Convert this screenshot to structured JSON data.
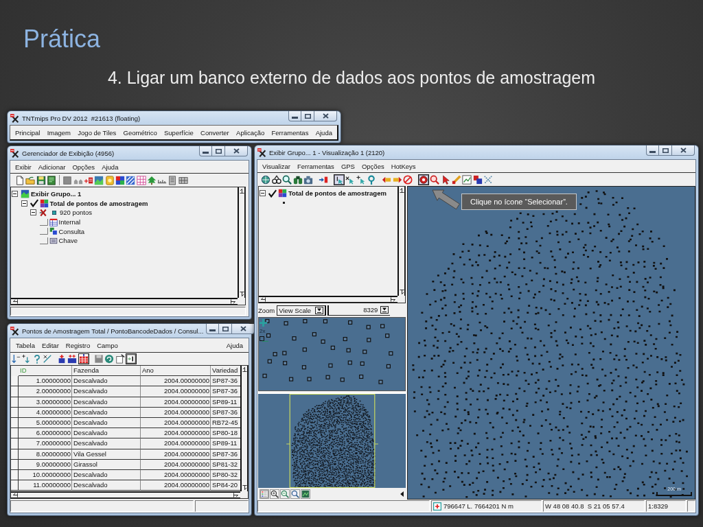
{
  "slide": {
    "title": "Prática",
    "subtitle": "4. Ligar um banco externo de dados aos pontos de amostragem"
  },
  "main_window": {
    "title": "TNTmips Pro DV 2012  #21613 (floating)",
    "menu": [
      "Principal",
      "Imagem",
      "Jogo de Tiles",
      "Geométrico",
      "Superfície",
      "Converter",
      "Aplicação",
      "Ferramentas",
      "Ajuda"
    ]
  },
  "display_manager": {
    "title": "Gerenciador de Exibição (4956)",
    "menu": [
      "Exibir",
      "Adicionar",
      "Opções",
      "Ajuda"
    ],
    "tree": [
      {
        "kind": "group",
        "label": "Exibir Grupo... 1",
        "expanded": true,
        "children": [
          {
            "kind": "layer",
            "label": "Total de pontos de amostragem",
            "checked": true,
            "expanded": true,
            "children": [
              {
                "kind": "points",
                "label": "920 pontos",
                "checked": false,
                "expanded": true,
                "children": [
                  {
                    "kind": "table",
                    "label": "Internal"
                  },
                  {
                    "kind": "query",
                    "label": "Consulta"
                  },
                  {
                    "kind": "key",
                    "label": "Chave"
                  }
                ]
              }
            ]
          }
        ]
      }
    ]
  },
  "table_window": {
    "title": "Pontos de Amostragem Total / PontoBancodeDados / Consul...",
    "menu": [
      "Tabela",
      "Editar",
      "Registro",
      "Campo"
    ],
    "help_menu": "Ajuda",
    "tools": [
      {
        "selected": false
      },
      {
        "selected": false
      },
      {
        "selected": false
      },
      {
        "selected": false
      },
      {
        "selected": false
      },
      {
        "selected": false
      },
      {
        "selected": true
      },
      {
        "selected": false
      },
      {
        "selected": false
      },
      {
        "selected": false
      },
      {
        "selected": true
      }
    ],
    "columns": [
      {
        "label": "ID",
        "key": true
      },
      {
        "label": "Fazenda",
        "key": false
      },
      {
        "label": "Ano",
        "key": false
      },
      {
        "label": "Variedad",
        "key": false
      }
    ],
    "rows": [
      [
        "1.00000000",
        "Descalvado",
        "2004.00000000",
        "SP87-36"
      ],
      [
        "2.00000000",
        "Descalvado",
        "2004.00000000",
        "SP87-36"
      ],
      [
        "3.00000000",
        "Descalvado",
        "2004.00000000",
        "SP89-11"
      ],
      [
        "4.00000000",
        "Descalvado",
        "2004.00000000",
        "SP87-36"
      ],
      [
        "5.00000000",
        "Descalvado",
        "2004.00000000",
        "RB72-45"
      ],
      [
        "6.00000000",
        "Descalvado",
        "2004.00000000",
        "SP80-18"
      ],
      [
        "7.00000000",
        "Descalvado",
        "2004.00000000",
        "SP89-11"
      ],
      [
        "8.00000000",
        "Vila Gessel",
        "2004.00000000",
        "SP87-36"
      ],
      [
        "9.00000000",
        "Girassol",
        "2004.00000000",
        "SP81-32"
      ],
      [
        "10.00000000",
        "Descalvado",
        "2004.00000000",
        "SP80-32"
      ],
      [
        "11.00000000",
        "Descalvado",
        "2004.00000000",
        "SP84-20"
      ]
    ]
  },
  "view_window": {
    "title": "Exibir Grupo... 1 - Visualização 1 (2120)",
    "menu": [
      "Visualizar",
      "Ferramentas",
      "GPS",
      "Opções",
      "HotKeys"
    ],
    "tools": [
      {
        "selected": false
      },
      {
        "selected": false
      },
      {
        "selected": false
      },
      {
        "selected": false
      },
      {
        "selected": false
      },
      {
        "selected": false
      },
      {
        "selected": true
      },
      {
        "selected": false
      },
      {
        "selected": false
      },
      {
        "selected": false
      },
      {
        "selected": false
      },
      {
        "selected": false
      },
      {
        "selected": false
      },
      {
        "selected": true
      },
      {
        "selected": false
      },
      {
        "selected": false
      },
      {
        "selected": false
      },
      {
        "selected": false
      },
      {
        "selected": false
      },
      {
        "selected": false
      }
    ],
    "legend": [
      {
        "label": "Total de pontos de amostragem",
        "checked": true,
        "expanded": true
      }
    ],
    "zoom": {
      "label": "Zoom",
      "mode": "View Scale",
      "value": "8329"
    },
    "locator_zoom": "2x",
    "callout": "Clique no ícone “Selecionar”.",
    "scale_bar": "200 m",
    "status": {
      "coordinates": "796647 L. 7664201 N m",
      "geographic": "W 48 08 40.8  S 21 05 57.4",
      "scale": "1:8329"
    }
  }
}
